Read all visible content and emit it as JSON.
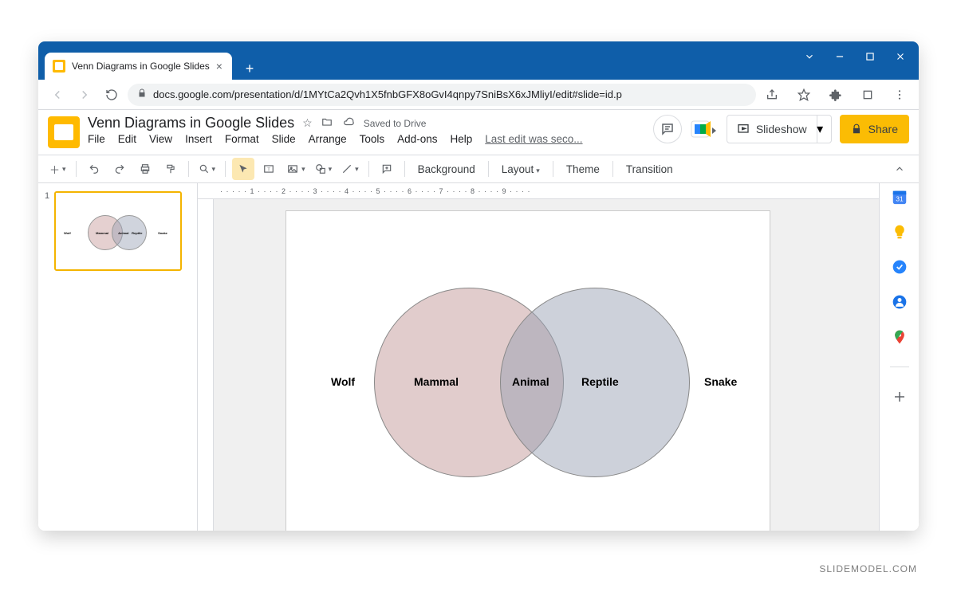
{
  "browser": {
    "tab_title": "Venn Diagrams in Google Slides",
    "url": "docs.google.com/presentation/d/1MYtCa2Qvh1X5fnbGFX8oGvI4qnpy7SniBsX6xJMliyI/edit#slide=id.p"
  },
  "header": {
    "doc_title": "Venn Diagrams in Google Slides",
    "saved_status": "Saved to Drive",
    "last_edit": "Last edit was seco...",
    "slideshow_label": "Slideshow",
    "share_label": "Share"
  },
  "menu": {
    "file": "File",
    "edit": "Edit",
    "view": "View",
    "insert": "Insert",
    "format": "Format",
    "slide": "Slide",
    "arrange": "Arrange",
    "tools": "Tools",
    "addons": "Add-ons",
    "help": "Help"
  },
  "toolbar": {
    "background": "Background",
    "layout": "Layout",
    "theme": "Theme",
    "transition": "Transition"
  },
  "filmstrip": {
    "slide1_num": "1"
  },
  "ruler": {
    "marks": "· · · · · 1 · · · · 2 · · · · 3 · · · · 4 · · · · 5 · · · · 6 · · · · 7 · · · · 8 · · · · 9 · · · ·"
  },
  "chart_data": {
    "type": "venn",
    "sets": [
      {
        "name": "Mammal",
        "outside_label": "Wolf",
        "color": "rgba(177,122,122,0.38)"
      },
      {
        "name": "Reptile",
        "outside_label": "Snake",
        "color": "rgba(150,158,178,0.48)"
      }
    ],
    "intersection_label": "Animal"
  },
  "watermark": "SLIDEMODEL.COM"
}
